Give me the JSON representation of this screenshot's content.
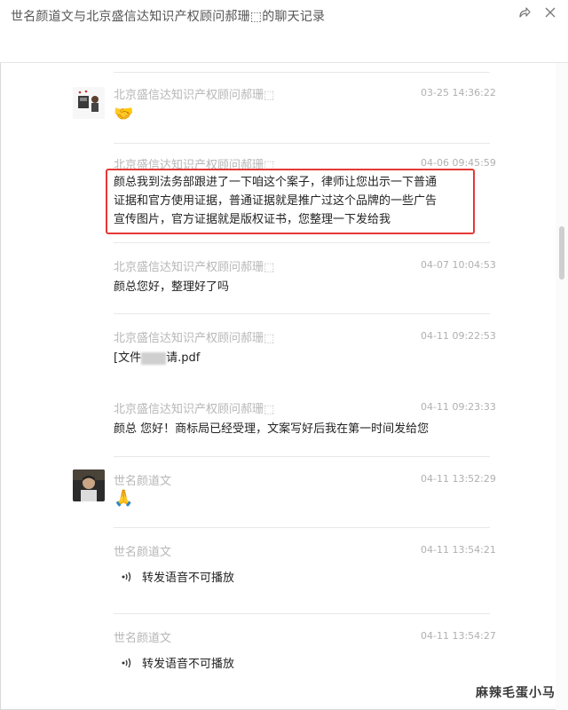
{
  "window": {
    "title": "世名颜道文与北京盛信达知识产权顾问郝珊⬚的聊天记录",
    "icons": [
      "share-icon",
      "close-icon"
    ]
  },
  "messages": [
    {
      "sender": "北京盛信达知识产权顾问郝珊⬚",
      "time": "03-25 14:36:22",
      "type": "emoji",
      "content": "🤝",
      "avatar": "avatar-consultant"
    },
    {
      "sender": "北京盛信达知识产权顾问郝珊⬚",
      "time": "04-06 09:45:59",
      "type": "text",
      "lines": [
        "颜总我到法务部跟进了一下咱这个案子，律师让您出示一下普通",
        "证据和官方使用证据，普通证据就是推广过这个品牌的一些广告",
        "宣传图片，官方证据就是版权证书，您整理一下发给我"
      ],
      "highlighted": true
    },
    {
      "sender": "北京盛信达知识产权顾问郝珊⬚",
      "time": "04-07 10:04:53",
      "type": "text",
      "lines": [
        "颜总您好，整理好了吗"
      ]
    },
    {
      "sender": "北京盛信达知识产权顾问郝珊⬚",
      "time": "04-11 09:22:53",
      "type": "file",
      "prefix": "[文件",
      "suffix": "请.pdf"
    },
    {
      "sender": "北京盛信达知识产权顾问郝珊⬚",
      "time": "04-11 09:23:33",
      "type": "text",
      "lines": [
        "颜总 您好！商标局已经受理，文案写好后我在第一时间发给您"
      ]
    },
    {
      "sender": "世名颜道文",
      "time": "04-11 13:52:29",
      "type": "emoji",
      "content": "🙏",
      "avatar": "avatar-user"
    },
    {
      "sender": "世名颜道文",
      "time": "04-11 13:54:21",
      "type": "voice",
      "content": "转发语音不可播放"
    },
    {
      "sender": "世名颜道文",
      "time": "04-11 13:54:27",
      "type": "voice",
      "content": "转发语音不可播放"
    }
  ],
  "watermark": "麻辣毛蛋小马"
}
